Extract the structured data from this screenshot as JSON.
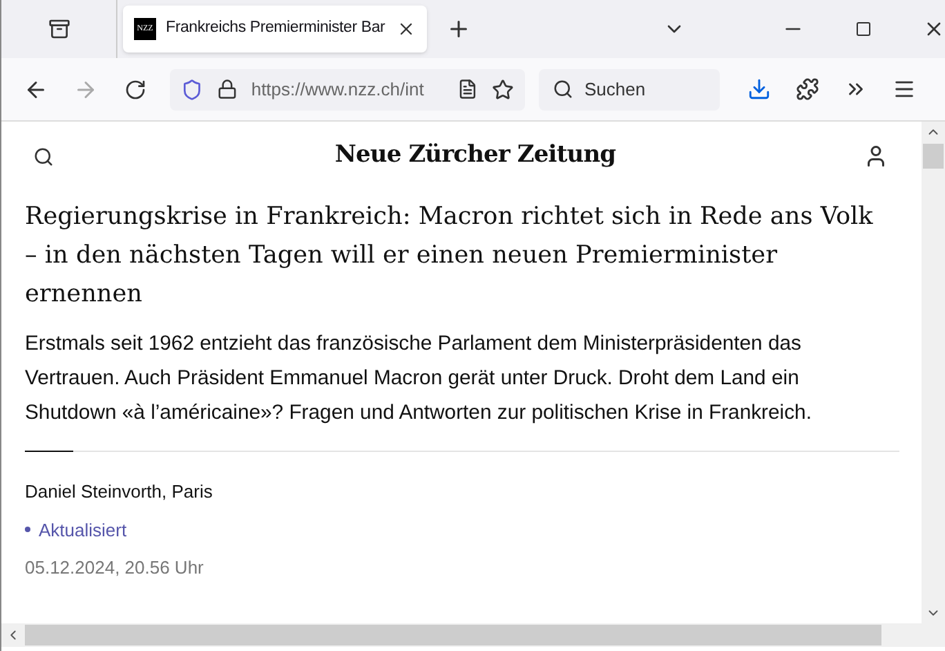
{
  "browser": {
    "tab": {
      "favicon": "NZZ",
      "title": "Frankreichs Premierminister Bar",
      "selected": true
    },
    "url": "https://www.nzz.ch/int",
    "search": {
      "placeholder": "Suchen"
    }
  },
  "site": {
    "logo": "Neue Zürcher Zeitung"
  },
  "article": {
    "headline": "Regierungskrise in Frankreich: Macron richtet sich in Rede ans Volk – in den nächsten Tagen will er einen neuen Premierminister ernennen",
    "lead": "Erstmals seit 1962 entzieht das französische Parlament dem Ministerpräsidenten das Vertrauen. Auch Präsident Emmanuel Macron gerät unter Druck. Droht dem Land ein Shutdown «à l’américaine»? Fragen und Antworten zur politischen Krise in Frankreich.",
    "author": "Daniel Steinvorth, Paris",
    "status": "Aktualisiert",
    "date": "05.12.2024, 20.56 Uhr"
  }
}
